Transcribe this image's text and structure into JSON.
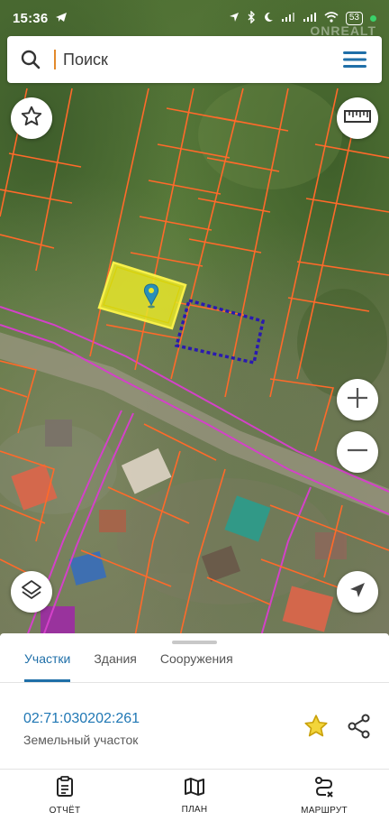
{
  "status_bar": {
    "time": "15:36",
    "battery": "53",
    "icons": [
      "telegram-icon",
      "location-icon",
      "bluetooth-icon",
      "moon-icon",
      "signal-icon",
      "signal-icon",
      "wifi-icon",
      "battery-icon"
    ]
  },
  "search": {
    "placeholder": "Поиск",
    "value": ""
  },
  "watermark": "ONREALT",
  "map": {
    "selected_parcel_color": "#e8e62a",
    "boundary_color": "#ff6a2a",
    "road_boundary_color": "#d441c9",
    "dotted_parcel_color": "#2a1ab0",
    "pin_color": "#2a8fb8"
  },
  "tabs": [
    {
      "label": "Участки",
      "active": true
    },
    {
      "label": "Здания",
      "active": false
    },
    {
      "label": "Сооружения",
      "active": false
    }
  ],
  "parcel": {
    "cadastral_number": "02:71:030202:261",
    "type": "Земельный участок"
  },
  "nav": [
    {
      "label": "ОТЧЁТ",
      "icon": "report-icon"
    },
    {
      "label": "ПЛАН",
      "icon": "map-icon"
    },
    {
      "label": "МАРШРУТ",
      "icon": "route-icon"
    }
  ],
  "colors": {
    "accent": "#1f6fa8",
    "link": "#1f77b4",
    "star": "#e6c21e"
  }
}
